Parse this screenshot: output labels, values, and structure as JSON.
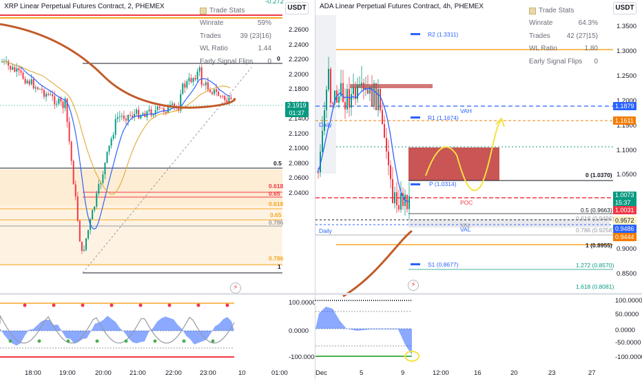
{
  "left": {
    "title": "XRP Linear Perpetual Futures Contract, 2, PHEMEX",
    "currency": "USDT",
    "stats": {
      "title": "Trade Stats",
      "rows": [
        {
          "label": "Winrate",
          "value": "59%"
        },
        {
          "label": "Trades",
          "value": "39 (23|16)"
        },
        {
          "label": "WL Ratio",
          "value": "1.44"
        },
        {
          "label": "Early Signal Flips",
          "value": "0"
        }
      ]
    },
    "top_partial_value": "-0.272",
    "price_ticks": [
      "2.2600",
      "2.2400",
      "2.2200",
      "2.2000",
      "2.1800",
      "2.1600",
      "2.1400",
      "2.1200",
      "2.1000",
      "2.0800",
      "2.0600",
      "2.0400"
    ],
    "price_tag": {
      "value": "2.1919",
      "timer": "01:37"
    },
    "fib_labels": [
      {
        "text": "0",
        "color": "#131722"
      },
      {
        "text": "0.5",
        "color": "#131722"
      },
      {
        "text": "0.618",
        "color": "#f23645"
      },
      {
        "text": "0.65",
        "color": "#f23645"
      },
      {
        "text": "0.618",
        "color": "#f5a623"
      },
      {
        "text": "0.65",
        "color": "#f5a623"
      },
      {
        "text": "0.786",
        "color": "#9598a1"
      },
      {
        "text": "0.786",
        "color": "#f5a623"
      },
      {
        "text": "1",
        "color": "#131722"
      }
    ],
    "osc_ticks": [
      "100.0000",
      "0.0000",
      "-100.0000"
    ],
    "time_ticks": [
      "18:00",
      "19:00",
      "20:00",
      "21:00",
      "22:00",
      "23:00",
      "10",
      "01:00"
    ]
  },
  "right": {
    "title": "ADA Linear Perpetual Futures Contract, 4h, PHEMEX",
    "currency": "USDT",
    "stats": {
      "title": "Trade Stats",
      "rows": [
        {
          "label": "Winrate",
          "value": "64.3%"
        },
        {
          "label": "Trades",
          "value": "42 (27|15)"
        },
        {
          "label": "WL Ratio",
          "value": "1.80"
        },
        {
          "label": "Early Signal Flips",
          "value": "0"
        }
      ]
    },
    "price_ticks": [
      "1.3500",
      "1.3000",
      "1.2500",
      "1.2000",
      "1.1500",
      "1.1000",
      "1.0500",
      "1.0000",
      "0.9500",
      "0.9000",
      "0.8500"
    ],
    "price_tags": [
      {
        "value": "1.1879",
        "color": "#2962ff"
      },
      {
        "value": "1.1611",
        "color": "#f57c00"
      },
      {
        "value": "1.0073",
        "timer": "15:37",
        "color": "#089981"
      },
      {
        "value": "1.0031",
        "color": "#f23645"
      },
      {
        "value": "0.9572",
        "color": "#fff3c4",
        "text_color": "#131722"
      },
      {
        "value": "0.9486",
        "color": "#2962ff"
      },
      {
        "value": "0.9444",
        "color": "#f57c00"
      }
    ],
    "pivots": [
      {
        "text": "R2 (1.3311)"
      },
      {
        "text": "R1 (1.1674)"
      },
      {
        "text": "P (1.0314)"
      },
      {
        "text": "S1 (0.8677)"
      }
    ],
    "markers": {
      "vah": "VAH",
      "poc": "POC",
      "val": "VAL",
      "daily1": "Daily",
      "daily2": "Daily",
      "val2": "VAL"
    },
    "fibs": [
      {
        "text": "0 (1.0370)"
      },
      {
        "text": "0.5 (0.9663)"
      },
      {
        "text": "0.618 (0.9496)"
      },
      {
        "text": "0.786 (0.9258)"
      },
      {
        "text": "1 (0.8955)"
      },
      {
        "text": "1.272 (0.8570)"
      },
      {
        "text": "1.618 (0.8081)"
      }
    ],
    "osc_ticks": [
      "100.0000",
      "50.0000",
      "0.0000",
      "-50.0000",
      "-100.0000"
    ],
    "time_ticks": [
      "Dec",
      "5",
      "9",
      "12:00",
      "16",
      "20",
      "23",
      "27"
    ]
  }
}
